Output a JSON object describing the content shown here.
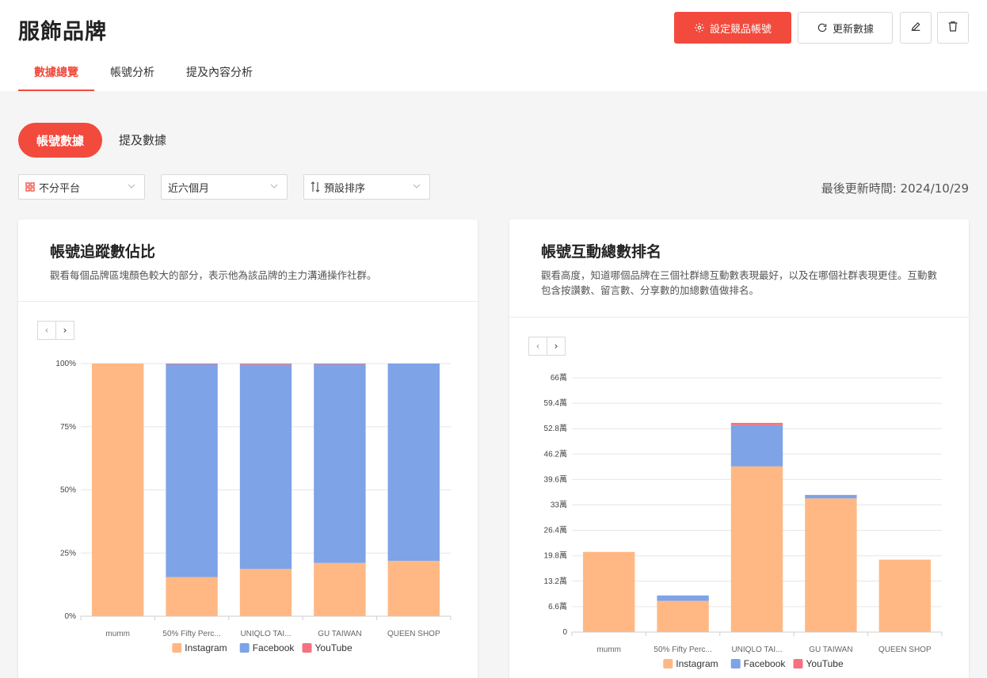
{
  "header": {
    "title": "服飾品牌",
    "primary_button": "設定競品帳號",
    "refresh_button": "更新數據"
  },
  "tabs": [
    {
      "label": "數據總覽",
      "active": true
    },
    {
      "label": "帳號分析",
      "active": false
    },
    {
      "label": "提及內容分析",
      "active": false
    }
  ],
  "subtabs": {
    "active": "帳號數據",
    "other": "提及數據"
  },
  "filters": {
    "platform": "不分平台",
    "period": "近六個月",
    "sort": "預設排序"
  },
  "last_updated": "最後更新時間: 2024/10/29",
  "colors": {
    "accent": "#f24a3d",
    "instagram": "#ffb883",
    "facebook": "#7ea3e6",
    "youtube": "#f5717f"
  },
  "cards": {
    "share": {
      "title": "帳號追蹤數佔比",
      "description": "觀看每個品牌區塊顏色較大的部分，表示他為該品牌的主力溝通操作社群。"
    },
    "ranking": {
      "title": "帳號互動總數排名",
      "description": "觀看高度，知道哪個品牌在三個社群總互動數表現最好，以及在哪個社群表現更佳。互動數包含按讚數、留言數、分享數的加總數值做排名。"
    }
  },
  "chart_data": [
    {
      "type": "bar",
      "stacked": true,
      "title": "帳號追蹤數佔比",
      "categories": [
        "mumm",
        "50% Fifty Perc...",
        "UNIQLO TAI...",
        "GU TAIWAN",
        "QUEEN SHOP"
      ],
      "series": [
        {
          "name": "Instagram",
          "values": [
            100,
            15.5,
            18.7,
            21.1,
            21.9
          ]
        },
        {
          "name": "Facebook",
          "values": [
            0,
            84.4,
            80.9,
            78.6,
            78.1
          ]
        },
        {
          "name": "YouTube",
          "values": [
            0,
            0.1,
            0.4,
            0.3,
            0
          ]
        }
      ],
      "yticks": [
        "0%",
        "25%",
        "50%",
        "75%",
        "100%"
      ],
      "ylim": [
        0,
        100
      ],
      "legend": "bottom"
    },
    {
      "type": "bar",
      "stacked": true,
      "title": "帳號互動總數排名",
      "categories": [
        "mumm",
        "50% Fifty Perc...",
        "UNIQLO TAI...",
        "GU TAIWAN",
        "QUEEN SHOP"
      ],
      "series": [
        {
          "name": "Instagram",
          "values": [
            20.8,
            8.1,
            43.0,
            34.7,
            18.8
          ]
        },
        {
          "name": "Facebook",
          "values": [
            0,
            1.4,
            10.7,
            0.9,
            0
          ]
        },
        {
          "name": "YouTube",
          "values": [
            0,
            0,
            0.6,
            0,
            0
          ]
        }
      ],
      "yticks": [
        "0",
        "6.6萬",
        "13.2萬",
        "19.8萬",
        "26.4萬",
        "33萬",
        "39.6萬",
        "46.2萬",
        "52.8萬",
        "59.4萬",
        "66萬"
      ],
      "yunit": "萬",
      "ylim": [
        0,
        66
      ],
      "legend": "bottom"
    }
  ]
}
